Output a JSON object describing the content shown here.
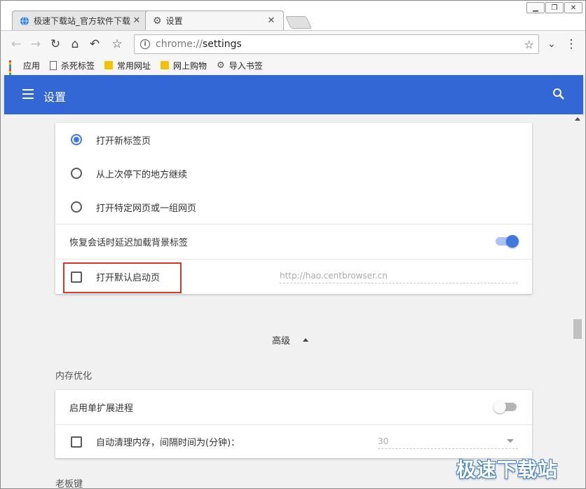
{
  "window": {
    "controls": [
      "minimize",
      "restore",
      "close"
    ]
  },
  "tabs": [
    {
      "label": "极速下载站_官方软件下载",
      "icon": "globe-icon"
    },
    {
      "label": "设置",
      "icon": "gear-icon",
      "active": true
    }
  ],
  "toolbar": {
    "url_scheme": "chrome://",
    "url_path": "settings"
  },
  "bookmarks": [
    {
      "label": "应用",
      "icon": "apps-icon"
    },
    {
      "label": "杀死标签",
      "icon": "page-icon"
    },
    {
      "label": "常用网址",
      "icon": "folder-icon"
    },
    {
      "label": "网上购物",
      "icon": "folder-icon"
    },
    {
      "label": "导入书签",
      "icon": "gear-icon"
    }
  ],
  "header": {
    "title": "设置"
  },
  "startup": {
    "options": [
      {
        "label": "打开新标签页",
        "selected": true
      },
      {
        "label": "从上次停下的地方继续",
        "selected": false
      },
      {
        "label": "打开特定网页或一组网页",
        "selected": false
      }
    ],
    "delay_load_label": "恢复会话时延迟加载背景标签",
    "delay_load_on": true,
    "default_page_label": "打开默认启动页",
    "default_page_checked": false,
    "default_page_placeholder": "http://hao.centbrowser.cn"
  },
  "advanced_label": "高级",
  "memory": {
    "section_title": "内存优化",
    "single_process_label": "启用单扩展进程",
    "single_process_on": false,
    "auto_clean_label": "自动清理内存，间隔时间为(分钟)：",
    "auto_clean_checked": false,
    "auto_clean_value": "30"
  },
  "boss_key": {
    "section_title": "老板键"
  },
  "watermark": "极速下载站",
  "colors": {
    "header_bg": "#3367d6",
    "accent": "#3f78e0",
    "highlight": "#d9352a"
  }
}
